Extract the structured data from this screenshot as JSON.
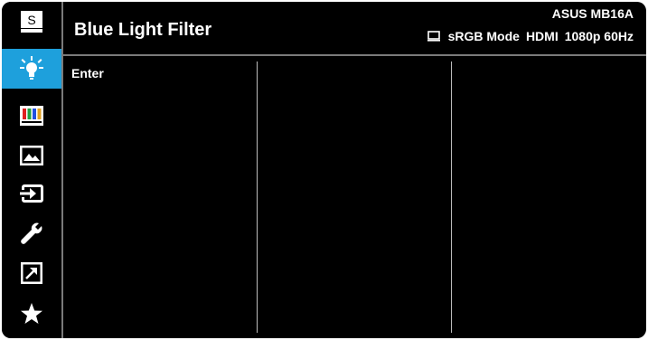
{
  "header": {
    "title": "Blue Light Filter",
    "model": "ASUS MB16A",
    "mode": "sRGB Mode",
    "input": "HDMI",
    "resolution": "1080p 60Hz"
  },
  "sidebar": {
    "items": [
      {
        "name": "splendid",
        "icon": "splendid-s-icon",
        "active": false
      },
      {
        "name": "blue-light-filter",
        "icon": "bulb-icon",
        "active": true
      },
      {
        "name": "color",
        "icon": "color-bars-icon",
        "active": false
      },
      {
        "name": "image",
        "icon": "image-icon",
        "active": false
      },
      {
        "name": "input-select",
        "icon": "input-icon",
        "active": false
      },
      {
        "name": "system-setup",
        "icon": "wrench-icon",
        "active": false
      },
      {
        "name": "shortcut",
        "icon": "shortcut-arrow-icon",
        "active": false
      },
      {
        "name": "my-favorite",
        "icon": "star-icon",
        "active": false
      }
    ]
  },
  "menu": {
    "column1": [
      "Enter"
    ]
  },
  "colors": {
    "background": "#000000",
    "accent": "#1ea0dc",
    "text": "#ffffff",
    "divider": "#7a7a7a"
  }
}
